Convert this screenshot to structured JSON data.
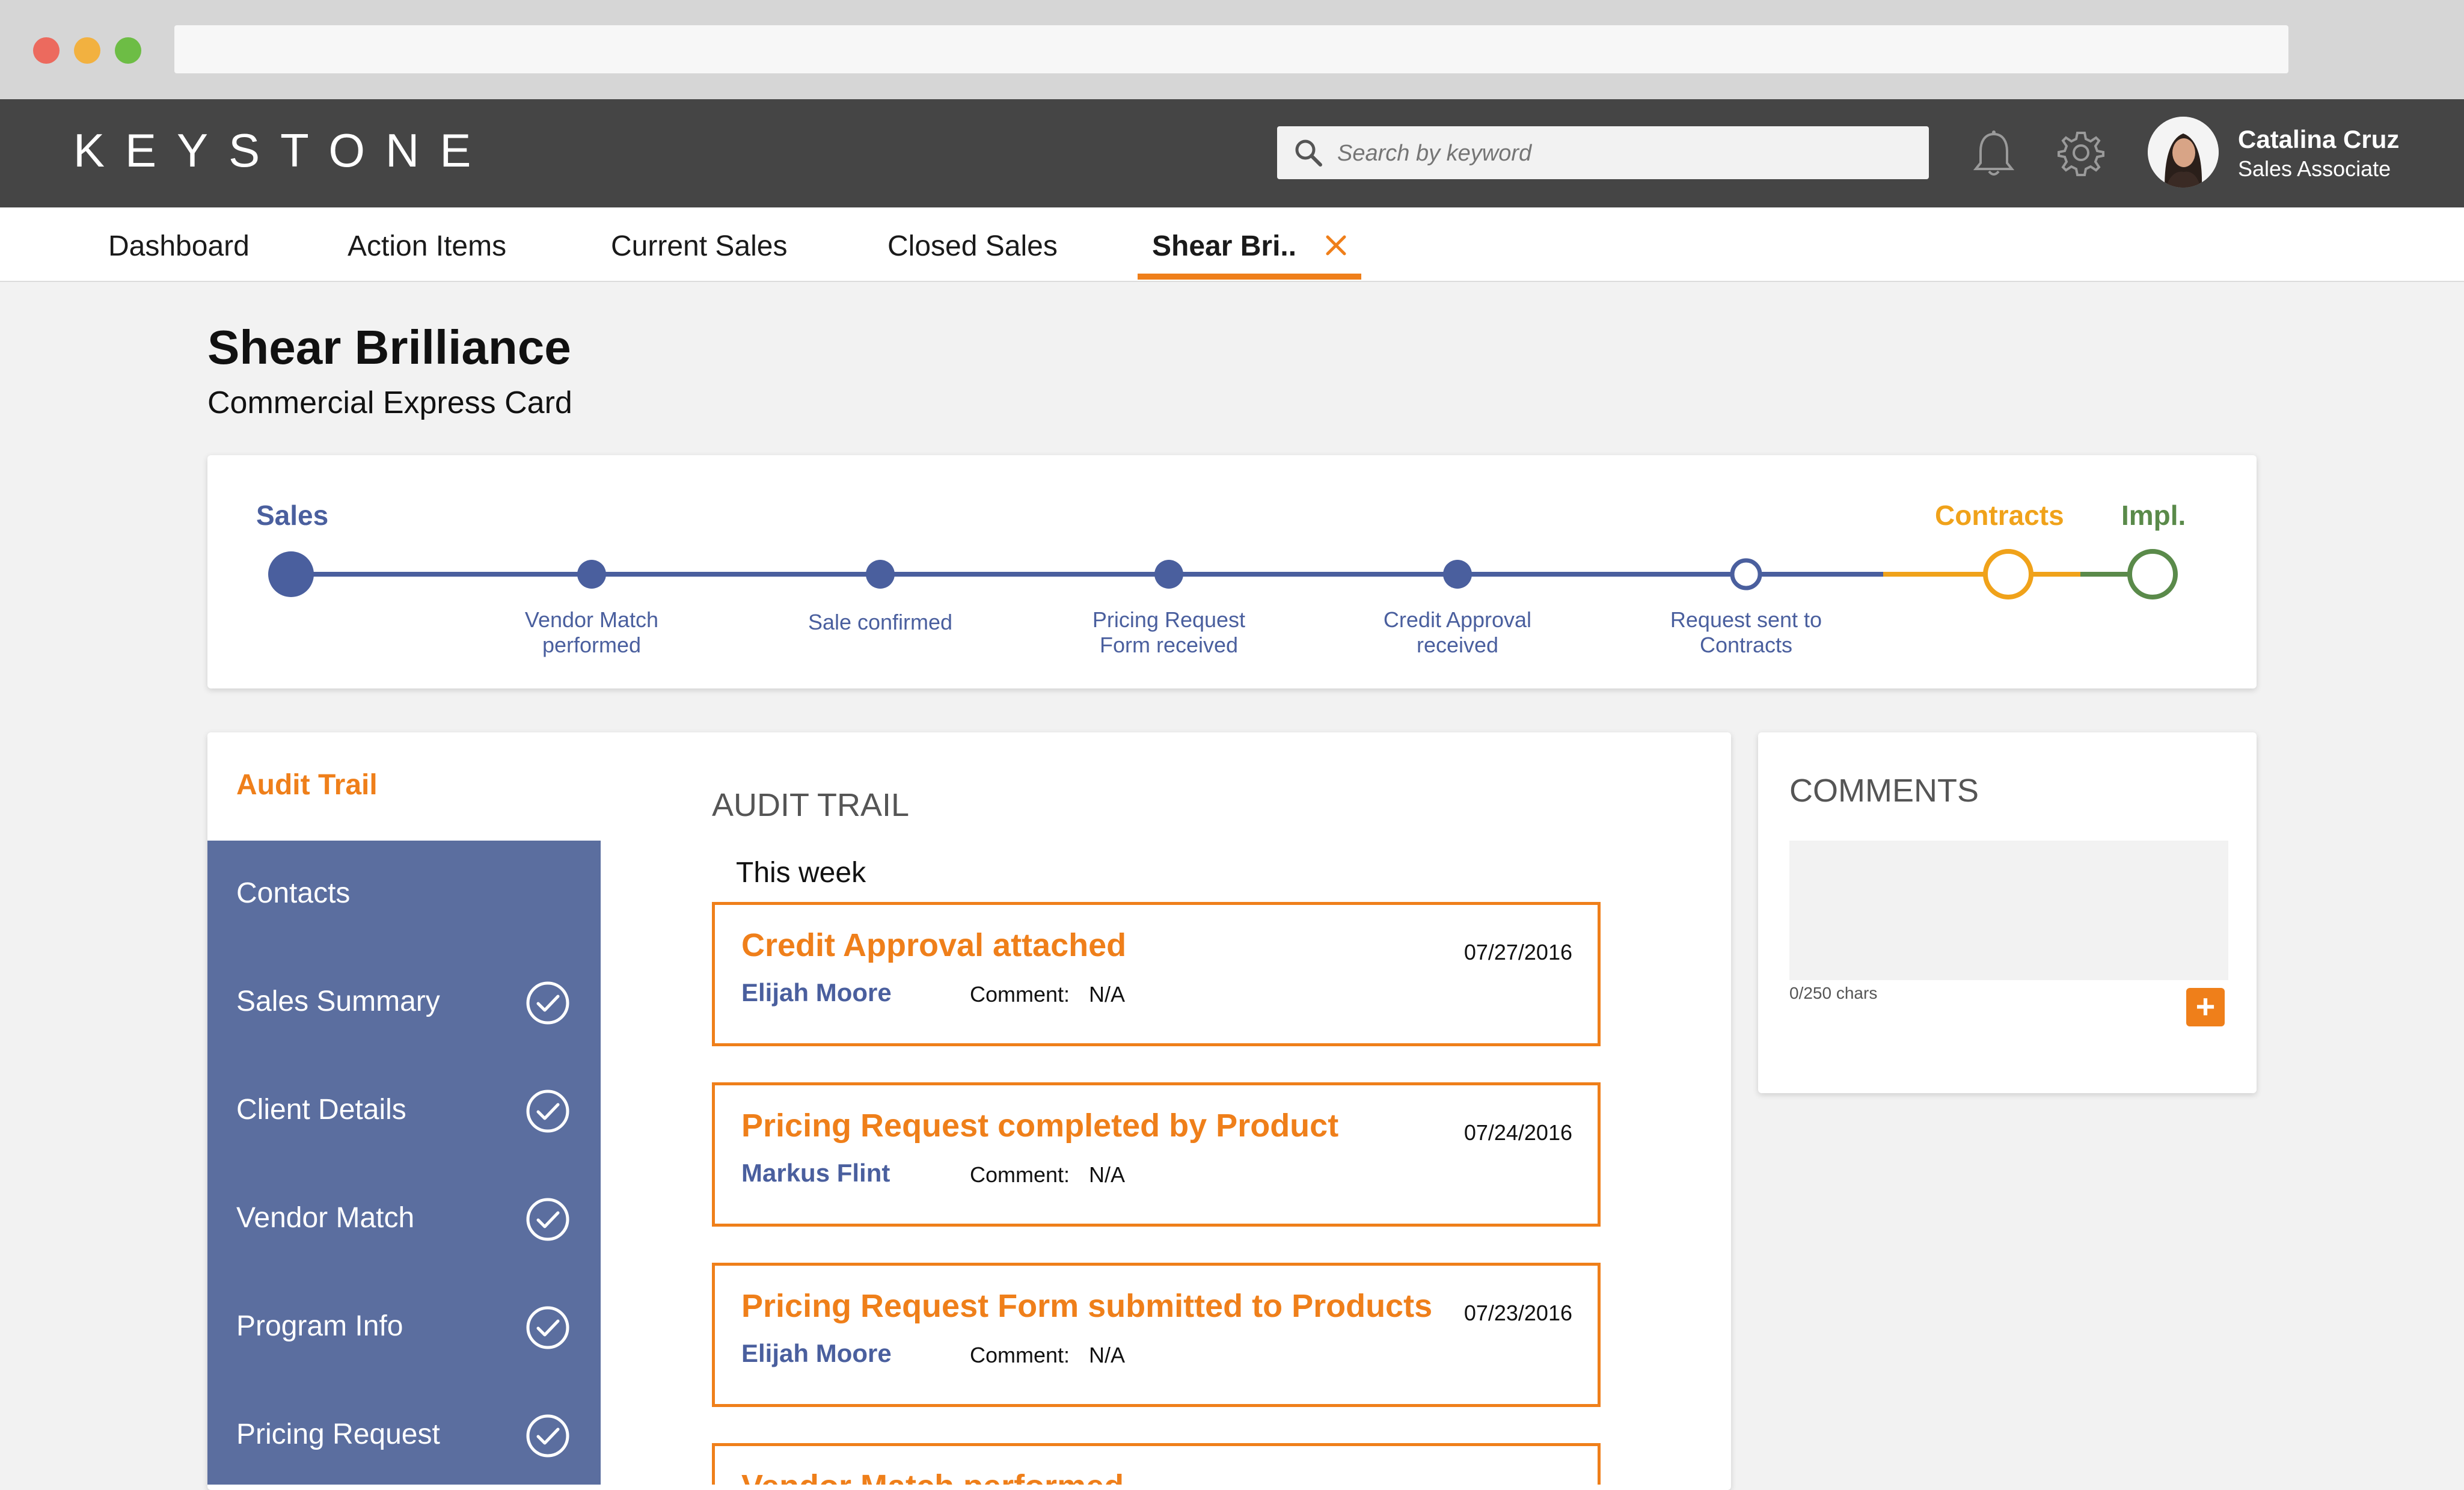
{
  "app": {
    "brand": "KEYSTONE"
  },
  "search": {
    "placeholder": "Search by keyword"
  },
  "user": {
    "name": "Catalina Cruz",
    "role": "Sales Associate"
  },
  "tabs": [
    {
      "label": "Dashboard"
    },
    {
      "label": "Action Items"
    },
    {
      "label": "Current Sales"
    },
    {
      "label": "Closed Sales"
    },
    {
      "label": "Shear Bri..",
      "active": true
    }
  ],
  "page": {
    "title": "Shear Brilliance",
    "subtitle": "Commercial Express Card"
  },
  "progress": {
    "stages": [
      {
        "label": "Sales",
        "color": "#4a5f9e"
      },
      {
        "label": "Contracts",
        "color": "#f0a21a"
      },
      {
        "label": "Impl.",
        "color": "#5a8a4a"
      }
    ],
    "steps": [
      {
        "label": "Vendor Match performed"
      },
      {
        "label": "Sale confirmed"
      },
      {
        "label": "Pricing Request Form received"
      },
      {
        "label": "Credit Approval received"
      },
      {
        "label": "Request sent to Contracts"
      }
    ]
  },
  "sidebar": {
    "active": "Audit Trail",
    "items": [
      {
        "label": "Contacts",
        "checked": false
      },
      {
        "label": "Sales Summary",
        "checked": true
      },
      {
        "label": "Client Details",
        "checked": true
      },
      {
        "label": "Vendor Match",
        "checked": true
      },
      {
        "label": "Program Info",
        "checked": true
      },
      {
        "label": "Pricing Request",
        "checked": true
      }
    ]
  },
  "audit": {
    "heading": "AUDIT TRAIL",
    "group": "This week",
    "comment_label": "Comment:",
    "entries": [
      {
        "title": "Credit Approval attached",
        "user": "Elijah Moore",
        "comment": "N/A",
        "date": "07/27/2016"
      },
      {
        "title": "Pricing Request completed by Product",
        "user": "Markus Flint",
        "comment": "N/A",
        "date": "07/24/2016"
      },
      {
        "title": "Pricing Request Form submitted to Products",
        "user": "Elijah Moore",
        "comment": "N/A",
        "date": "07/23/2016"
      },
      {
        "title": "Vendor Match performed",
        "user": "",
        "comment": "",
        "date": ""
      }
    ]
  },
  "comments": {
    "title": "COMMENTS",
    "chars": "0/250 chars",
    "add_label": "+"
  },
  "colors": {
    "accent": "#ef7f1a",
    "primary": "#4a5f9e",
    "sidebar": "#5b6e9f",
    "contracts": "#f0a21a",
    "impl": "#5a8a4a"
  }
}
